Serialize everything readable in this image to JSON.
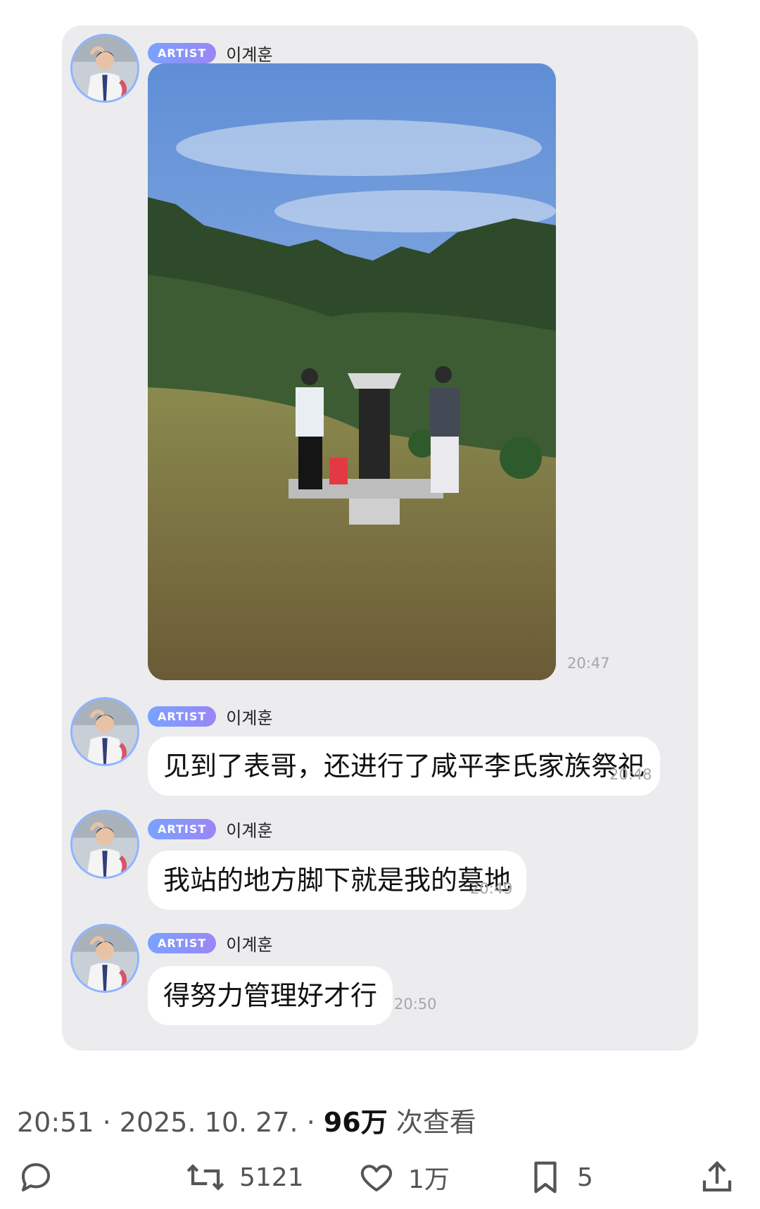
{
  "messages": [
    {
      "badge": "ARTIST",
      "name": "이계훈",
      "type": "image",
      "time": "20:47"
    },
    {
      "badge": "ARTIST",
      "name": "이계훈",
      "type": "text",
      "text": "见到了表哥，还进行了咸平李氏家族祭祀",
      "time": "20:48"
    },
    {
      "badge": "ARTIST",
      "name": "이계훈",
      "type": "text",
      "text": "我站的地方脚下就是我的墓地",
      "time": "20:49"
    },
    {
      "badge": "ARTIST",
      "name": "이계훈",
      "type": "text",
      "text": "得努力管理好才行",
      "time": "20:50"
    }
  ],
  "footer": {
    "time": "20:51",
    "date": "2025. 10. 27.",
    "views_count": "96万",
    "views_label": "次查看"
  },
  "actions": {
    "reply_icon": "comment-icon",
    "retweet_icon": "retweet-icon",
    "retweets": "5121",
    "like_icon": "heart-icon",
    "likes": "1万",
    "bookmark_icon": "bookmark-icon",
    "bookmarks": "5",
    "share_icon": "share-icon"
  },
  "colors": {
    "card": "#ececef",
    "badge_start": "#7aa2ff",
    "badge_end": "#9a86f6",
    "avatar_ring": "#8fb4ff",
    "timestamp": "#a6a6ab"
  }
}
